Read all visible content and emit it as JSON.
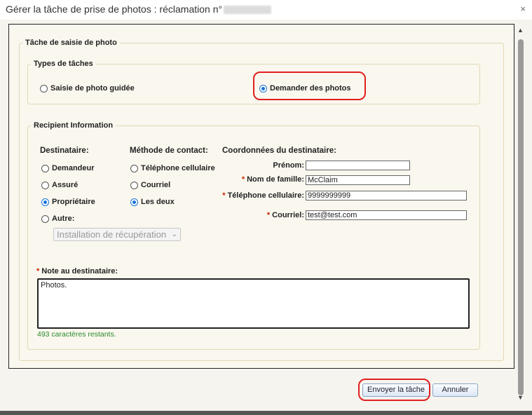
{
  "dialog": {
    "title_prefix": "Gérer la tâche de prise de photos : réclamation n°",
    "close_glyph": "×"
  },
  "section_main": {
    "legend": "Tâche de saisie de photo"
  },
  "task_types": {
    "legend": "Types de tâches",
    "options": [
      {
        "label": "Saisie de photo guidée",
        "selected": false
      },
      {
        "label": "Demander des photos",
        "selected": true
      }
    ]
  },
  "recipient": {
    "legend": "Recipient Information",
    "destinataire": {
      "header": "Destinataire:",
      "options": [
        {
          "label": "Demandeur",
          "selected": false
        },
        {
          "label": "Assuré",
          "selected": false
        },
        {
          "label": "Propriétaire",
          "selected": true
        },
        {
          "label": "Autre:",
          "selected": false
        }
      ],
      "other_select_value": "Installation de récupération"
    },
    "contact_method": {
      "header": "Méthode de contact:",
      "options": [
        {
          "label": "Téléphone cellulaire",
          "selected": false
        },
        {
          "label": "Courriel",
          "selected": false
        },
        {
          "label": "Les deux",
          "selected": true
        }
      ]
    },
    "coordinates": {
      "header": "Coordonnées du destinataire:",
      "fields": [
        {
          "label": "Prénom:",
          "required": false,
          "value": ""
        },
        {
          "label": "Nom de famille:",
          "required": true,
          "value": "McClaim"
        },
        {
          "label": "Téléphone cellulaire:",
          "required": true,
          "value": "9999999999"
        },
        {
          "label": "Courriel:",
          "required": true,
          "value": "test@test.com"
        }
      ]
    },
    "note": {
      "label": "Note au destinataire:",
      "required": true,
      "value": "Photos.",
      "remaining": "493 caractères restants."
    }
  },
  "buttons": {
    "submit": "Envoyer la tâche",
    "cancel": "Annuler"
  },
  "colors": {
    "highlight": "#e02020",
    "radio_selected": "#1a73d9",
    "remaining_text": "#2a8a2a"
  }
}
